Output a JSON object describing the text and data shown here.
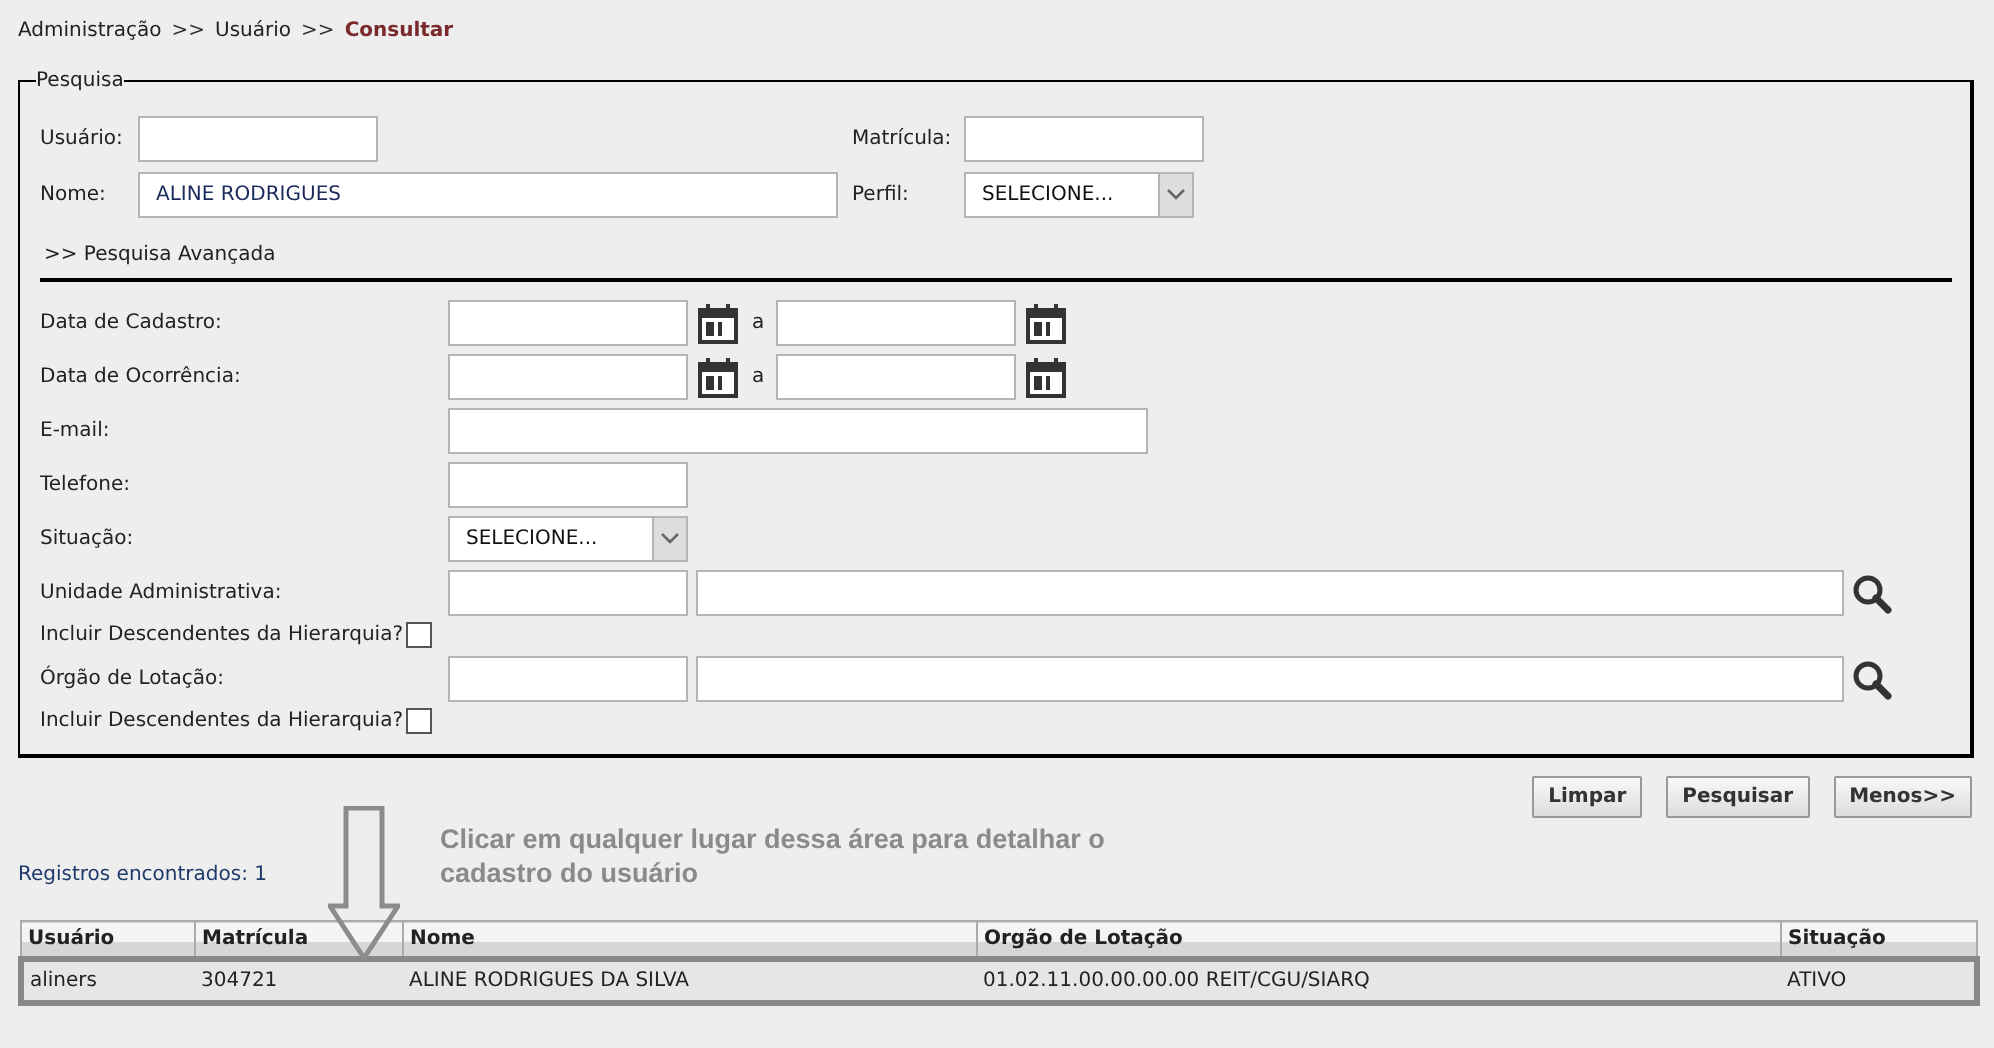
{
  "breadcrumb": [
    {
      "label": "Administração",
      "current": false
    },
    {
      "label": ">>",
      "kind": "sep"
    },
    {
      "label": "Usuário",
      "current": false
    },
    {
      "label": ">>",
      "kind": "sep"
    },
    {
      "label": "Consultar",
      "current": true
    }
  ],
  "search": {
    "legend": "Pesquisa",
    "usuario": {
      "label": "Usuário:"
    },
    "matricula": {
      "label": "Matrícula:"
    },
    "nome": {
      "label": "Nome:",
      "value": "ALINE RODRIGUES"
    },
    "perfil": {
      "label": "Perfil:",
      "value": "SELECIONE..."
    },
    "advanced_title": ">> Pesquisa Avançada",
    "advanced": [
      {
        "kind": "date_range",
        "label": "Data de Cadastro:",
        "joiner": "a"
      },
      {
        "kind": "date_range",
        "label": "Data de Ocorrência:",
        "joiner": "a"
      },
      {
        "kind": "text_wide",
        "label": "E-mail:"
      },
      {
        "kind": "text",
        "label": "Telefone:"
      },
      {
        "kind": "select",
        "label": "Situação:",
        "value": "SELECIONE..."
      },
      {
        "kind": "lookup",
        "label": "Unidade Administrativa:"
      },
      {
        "kind": "checkbox",
        "label": "Incluir Descendentes da Hierarquia?",
        "checked": false
      },
      {
        "kind": "lookup",
        "label": "Órgão de Lotação:"
      },
      {
        "kind": "checkbox",
        "label": "Incluir Descendentes da Hierarquia?",
        "checked": false
      }
    ]
  },
  "buttons": [
    "Limpar",
    "Pesquisar",
    "Menos>>"
  ],
  "annotation": "Clicar em qualquer lugar dessa área para detalhar o cadastro do usuário",
  "records_found": "Registros encontrados: 1",
  "table": {
    "columns": [
      "Usuário",
      "Matrícula",
      "Nome",
      "Orgão de Lotação",
      "Situação"
    ],
    "rows": [
      {
        "cells": [
          "aliners",
          "304721",
          "ALINE RODRIGUES DA SILVA",
          "01.02.11.00.00.00.00 REIT/CGU/SIARQ",
          "ATIVO"
        ],
        "highlighted": true
      }
    ]
  }
}
